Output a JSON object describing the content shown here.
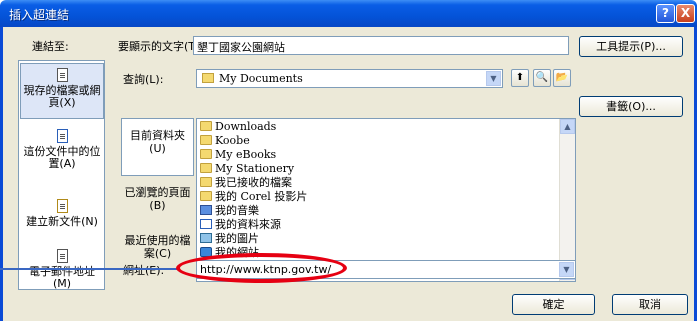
{
  "window": {
    "title": "插入超連結",
    "help_glyph": "?",
    "close_glyph": "X"
  },
  "link_to": {
    "label": "連結至:",
    "items": [
      {
        "label": "現存的檔案或網頁(X)",
        "icon": "existing-file-icon"
      },
      {
        "label": "這份文件中的位置(A)",
        "icon": "place-in-document-icon"
      },
      {
        "label": "建立新文件(N)",
        "icon": "new-document-icon"
      },
      {
        "label": "電子郵件地址(M)",
        "icon": "email-address-icon"
      }
    ]
  },
  "display_text": {
    "label": "要顯示的文字(T):",
    "value": "墾丁國家公園網站"
  },
  "screentip_button": "工具提示(P)...",
  "look_in": {
    "label": "查詢(L):",
    "value": "My Documents"
  },
  "bookmark_button": "書籤(O)...",
  "shortcuts": [
    {
      "label": "目前資料夾(U)"
    },
    {
      "label": "已瀏覽的頁面(B)"
    },
    {
      "label": "最近使用的檔案(C)"
    }
  ],
  "files": [
    {
      "name": "Downloads",
      "icon": "folder-icon"
    },
    {
      "name": "Koobe",
      "icon": "folder-icon"
    },
    {
      "name": "My eBooks",
      "icon": "folder-icon"
    },
    {
      "name": "My Stationery",
      "icon": "folder-icon"
    },
    {
      "name": "我已接收的檔案",
      "icon": "folder-icon"
    },
    {
      "name": "我的 Corel 投影片",
      "icon": "folder-icon"
    },
    {
      "name": "我的音樂",
      "icon": "music-folder-icon"
    },
    {
      "name": "我的資料來源",
      "icon": "data-source-icon"
    },
    {
      "name": "我的圖片",
      "icon": "pictures-folder-icon"
    },
    {
      "name": "我的網站",
      "icon": "web-folder-icon"
    }
  ],
  "address": {
    "label": "網址(E):",
    "value": "http://www.ktnp.gov.tw/"
  },
  "ok_button": "確定",
  "cancel_button": "取消",
  "colors": {
    "highlight": "#e60012",
    "titlebar": "#0453d8"
  }
}
